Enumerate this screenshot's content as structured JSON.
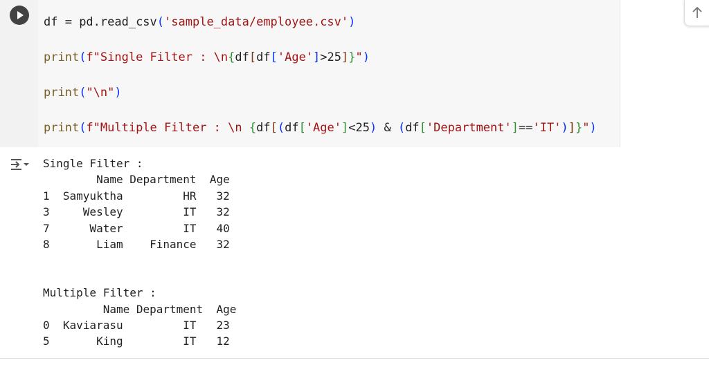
{
  "cell": {
    "code_lines": [
      {
        "parts": [
          [
            "op",
            "df = "
          ],
          [
            "op",
            "pd.read_csv"
          ],
          [
            "p1",
            "("
          ],
          [
            "s",
            "'sample_data/employee.csv'"
          ],
          [
            "p1",
            ")"
          ]
        ]
      },
      {
        "parts": [
          [
            "f",
            "print"
          ],
          [
            "p1",
            "("
          ],
          [
            "s",
            "f\"Single Filter : \\n"
          ],
          [
            "p2",
            "{"
          ],
          [
            "op",
            "df"
          ],
          [
            "p3",
            "["
          ],
          [
            "op",
            "df"
          ],
          [
            "p1",
            "["
          ],
          [
            "s",
            "'Age'"
          ],
          [
            "p1",
            "]"
          ],
          [
            "op",
            ">25"
          ],
          [
            "p3",
            "]"
          ],
          [
            "p2",
            "}"
          ],
          [
            "s",
            "\""
          ],
          [
            "p1",
            ")"
          ]
        ]
      },
      {
        "parts": [
          [
            "f",
            "print"
          ],
          [
            "p1",
            "("
          ],
          [
            "s",
            "\"\\n\""
          ],
          [
            "p1",
            ")"
          ]
        ]
      },
      {
        "parts": [
          [
            "f",
            "print"
          ],
          [
            "p1",
            "("
          ],
          [
            "s",
            "f\"Multiple Filter : \\n "
          ],
          [
            "p2",
            "{"
          ],
          [
            "op",
            "df"
          ],
          [
            "p3",
            "["
          ],
          [
            "p1",
            "("
          ],
          [
            "op",
            "df"
          ],
          [
            "p2",
            "["
          ],
          [
            "s",
            "'Age'"
          ],
          [
            "p2",
            "]"
          ],
          [
            "op",
            "<25"
          ],
          [
            "p1",
            ")"
          ],
          [
            "op",
            " & "
          ],
          [
            "p1",
            "("
          ],
          [
            "op",
            "df"
          ],
          [
            "p2",
            "["
          ],
          [
            "s",
            "'Department'"
          ],
          [
            "p2",
            "]"
          ],
          [
            "op",
            "=="
          ],
          [
            "s",
            "'IT'"
          ],
          [
            "p1",
            ")"
          ],
          [
            "p3",
            "]"
          ],
          [
            "p2",
            "}"
          ],
          [
            "s",
            "\""
          ],
          [
            "p1",
            ")"
          ]
        ]
      }
    ],
    "output_lines": [
      "Single Filter :",
      "        Name Department  Age",
      "1  Samyuktha         HR   32",
      "3     Wesley         IT   32",
      "7      Water         IT   40",
      "8       Liam    Finance   32",
      "",
      "",
      "Multiple Filter :",
      "         Name Department  Age",
      "0  Kaviarasu         IT   23",
      "5       King         IT   12"
    ]
  },
  "icons": {
    "run": "play-icon",
    "output": "output-collapse-icon",
    "scroll": "arrow-up-icon"
  }
}
